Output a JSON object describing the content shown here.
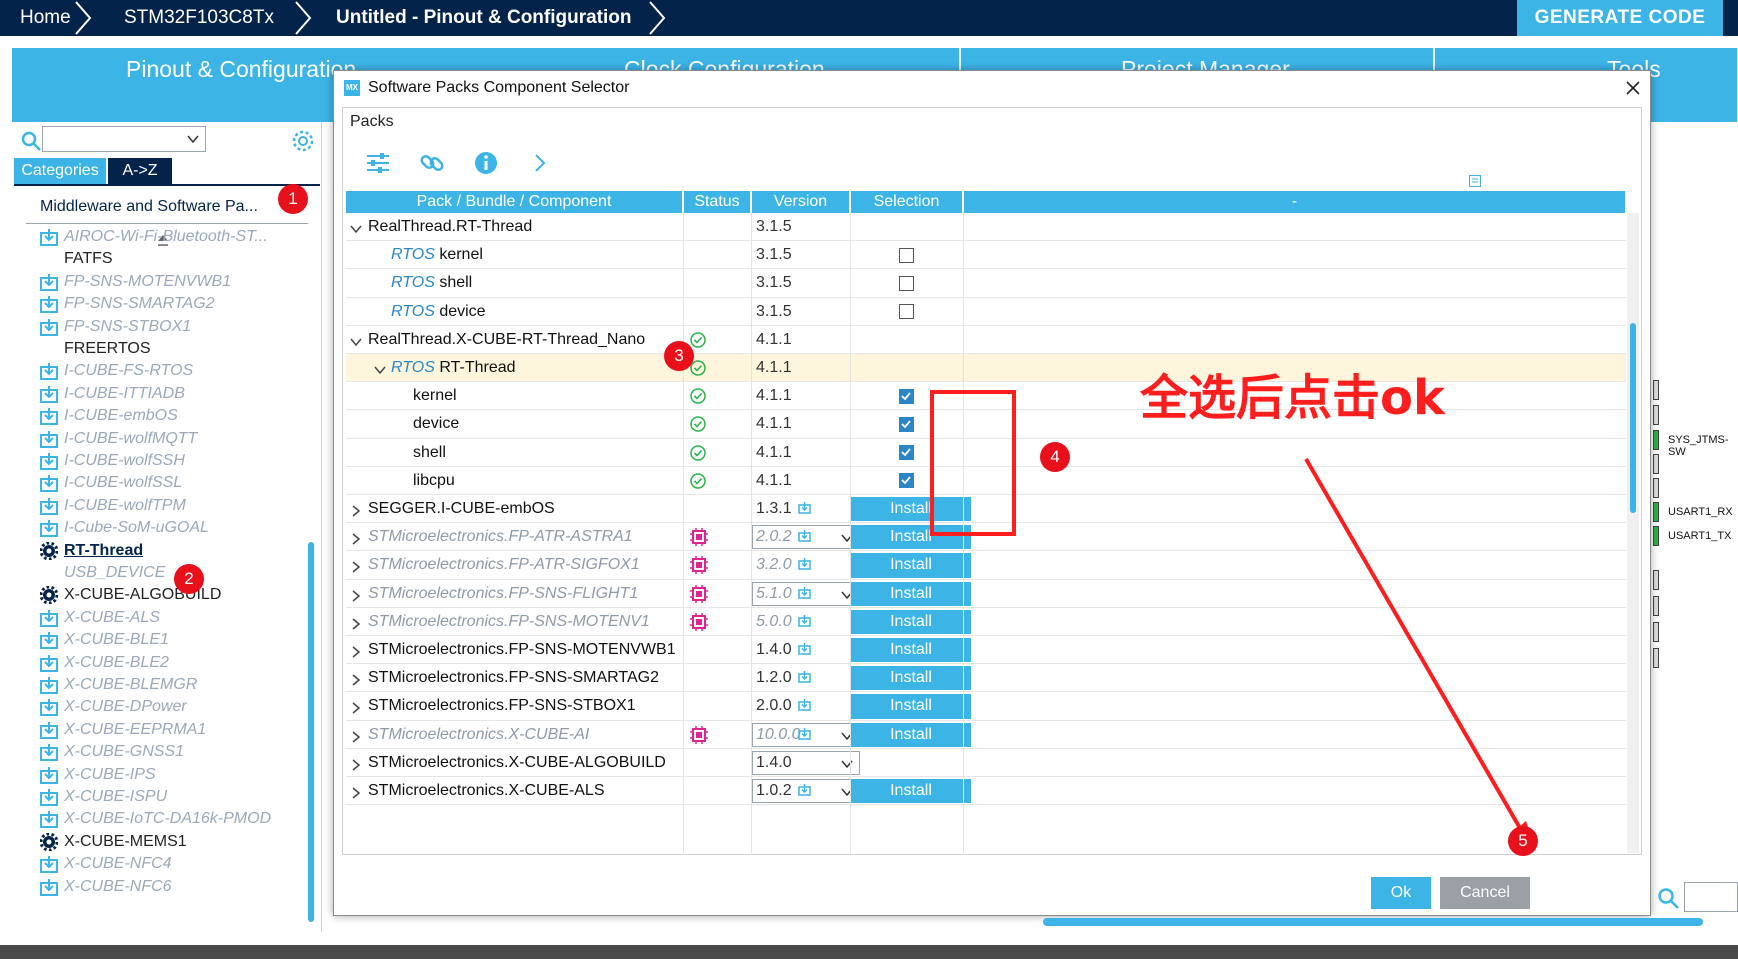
{
  "breadcrumb": {
    "home": "Home",
    "device": "STM32F103C8Tx",
    "project": "Untitled - Pinout & Configuration"
  },
  "generate_code": "GENERATE CODE",
  "tabs": [
    "Pinout & Configuration",
    "Clock Configuration",
    "Project Manager",
    "Tools"
  ],
  "left_panel": {
    "tab_categories": "Categories",
    "tab_az": "A->Z",
    "category_select": "Middleware and Software Pa...",
    "items": [
      {
        "label": "AIROC-Wi-Fi-Bluetooth-ST...",
        "style": "dim",
        "icon": "download-icon"
      },
      {
        "label": "FATFS",
        "style": "normal",
        "icon": ""
      },
      {
        "label": "FP-SNS-MOTENVWB1",
        "style": "dim",
        "icon": "download-icon"
      },
      {
        "label": "FP-SNS-SMARTAG2",
        "style": "dim",
        "icon": "download-icon"
      },
      {
        "label": "FP-SNS-STBOX1",
        "style": "dim",
        "icon": "download-icon"
      },
      {
        "label": "FREERTOS",
        "style": "normal",
        "icon": ""
      },
      {
        "label": "I-CUBE-FS-RTOS",
        "style": "dim",
        "icon": "download-icon"
      },
      {
        "label": "I-CUBE-ITTIADB",
        "style": "dim",
        "icon": "download-icon"
      },
      {
        "label": "I-CUBE-embOS",
        "style": "dim",
        "icon": "download-icon"
      },
      {
        "label": "I-CUBE-wolfMQTT",
        "style": "dim",
        "icon": "download-icon"
      },
      {
        "label": "I-CUBE-wolfSSH",
        "style": "dim",
        "icon": "download-icon"
      },
      {
        "label": "I-CUBE-wolfSSL",
        "style": "dim",
        "icon": "download-icon"
      },
      {
        "label": "I-CUBE-wolfTPM",
        "style": "dim",
        "icon": "download-icon"
      },
      {
        "label": "I-Cube-SoM-uGOAL",
        "style": "dim",
        "icon": "download-icon"
      },
      {
        "label": "RT-Thread",
        "style": "active",
        "icon": "gear-icon"
      },
      {
        "label": "USB_DEVICE",
        "style": "dim",
        "icon": ""
      },
      {
        "label": "X-CUBE-ALGOBUILD",
        "style": "normal",
        "icon": "gear-icon"
      },
      {
        "label": "X-CUBE-ALS",
        "style": "dim",
        "icon": "download-icon"
      },
      {
        "label": "X-CUBE-BLE1",
        "style": "dim",
        "icon": "download-icon"
      },
      {
        "label": "X-CUBE-BLE2",
        "style": "dim",
        "icon": "download-icon"
      },
      {
        "label": "X-CUBE-BLEMGR",
        "style": "dim",
        "icon": "download-icon"
      },
      {
        "label": "X-CUBE-DPower",
        "style": "dim",
        "icon": "download-icon"
      },
      {
        "label": "X-CUBE-EEPRMA1",
        "style": "dim",
        "icon": "download-icon"
      },
      {
        "label": "X-CUBE-GNSS1",
        "style": "dim",
        "icon": "download-icon"
      },
      {
        "label": "X-CUBE-IPS",
        "style": "dim",
        "icon": "download-icon"
      },
      {
        "label": "X-CUBE-ISPU",
        "style": "dim",
        "icon": "download-icon"
      },
      {
        "label": "X-CUBE-IoTC-DA16k-PMOD",
        "style": "dim",
        "icon": "download-icon"
      },
      {
        "label": "X-CUBE-MEMS1",
        "style": "normal",
        "icon": "gear-icon"
      },
      {
        "label": "X-CUBE-NFC4",
        "style": "dim",
        "icon": "download-icon"
      },
      {
        "label": "X-CUBE-NFC6",
        "style": "dim",
        "icon": "download-icon"
      }
    ]
  },
  "badges": [
    "1",
    "2",
    "3",
    "4",
    "5"
  ],
  "right_labels": [
    "SYS_JTMS-SW",
    "USART1_RX",
    "USART1_TX"
  ],
  "dialog": {
    "title": "Software Packs Component Selector",
    "packs_label": "Packs",
    "headers": [
      "Pack / Bundle / Component",
      "Status",
      "Version",
      "Selection",
      "-"
    ],
    "rtos_prefix": "RTOS",
    "install_label": "Install",
    "rows": [
      {
        "level": 0,
        "expand": "down",
        "name": "RealThread.RT-Thread",
        "dim": false,
        "status": "none",
        "version": "3.1.5",
        "selection": "none"
      },
      {
        "level": 1,
        "expand": "",
        "rtos": true,
        "name": "kernel",
        "dim": false,
        "status": "none",
        "version": "3.1.5",
        "selection": "unchecked"
      },
      {
        "level": 1,
        "expand": "",
        "rtos": true,
        "name": "shell",
        "dim": false,
        "status": "none",
        "version": "3.1.5",
        "selection": "unchecked"
      },
      {
        "level": 1,
        "expand": "",
        "rtos": true,
        "name": "device",
        "dim": false,
        "status": "none",
        "version": "3.1.5",
        "selection": "unchecked"
      },
      {
        "level": 0,
        "expand": "down",
        "name": "RealThread.X-CUBE-RT-Thread_Nano",
        "dim": false,
        "status": "ok",
        "version": "4.1.1",
        "selection": "none"
      },
      {
        "level": 1,
        "expand": "down",
        "rtos": true,
        "name": "RT-Thread",
        "dim": false,
        "status": "ok",
        "version": "4.1.1",
        "selection": "none",
        "highlight": true
      },
      {
        "level": 2,
        "expand": "",
        "name": "kernel",
        "dim": false,
        "status": "ok",
        "version": "4.1.1",
        "selection": "checked"
      },
      {
        "level": 2,
        "expand": "",
        "name": "device",
        "dim": false,
        "status": "ok",
        "version": "4.1.1",
        "selection": "checked"
      },
      {
        "level": 2,
        "expand": "",
        "name": "shell",
        "dim": false,
        "status": "ok",
        "version": "4.1.1",
        "selection": "checked"
      },
      {
        "level": 2,
        "expand": "",
        "name": "libcpu",
        "dim": false,
        "status": "ok",
        "version": "4.1.1",
        "selection": "checked"
      },
      {
        "level": 0,
        "expand": "right",
        "name": "SEGGER.I-CUBE-embOS",
        "dim": false,
        "status": "none",
        "version": "1.3.1",
        "verbox": false,
        "selection": "install"
      },
      {
        "level": 0,
        "expand": "right",
        "name": "STMicroelectronics.FP-ATR-ASTRA1",
        "dim": true,
        "status": "chip",
        "version": "2.0.2",
        "verbox": true,
        "selection": "install"
      },
      {
        "level": 0,
        "expand": "right",
        "name": "STMicroelectronics.FP-ATR-SIGFOX1",
        "dim": true,
        "status": "chip",
        "version": "3.2.0",
        "verbox": false,
        "selection": "install"
      },
      {
        "level": 0,
        "expand": "right",
        "name": "STMicroelectronics.FP-SNS-FLIGHT1",
        "dim": true,
        "status": "chip",
        "version": "5.1.0",
        "verbox": true,
        "selection": "install"
      },
      {
        "level": 0,
        "expand": "right",
        "name": "STMicroelectronics.FP-SNS-MOTENV1",
        "dim": true,
        "status": "chip",
        "version": "5.0.0",
        "verbox": false,
        "selection": "install"
      },
      {
        "level": 0,
        "expand": "right",
        "name": "STMicroelectronics.FP-SNS-MOTENVWB1",
        "dim": false,
        "status": "none",
        "version": "1.4.0",
        "verbox": false,
        "selection": "install"
      },
      {
        "level": 0,
        "expand": "right",
        "name": "STMicroelectronics.FP-SNS-SMARTAG2",
        "dim": false,
        "status": "none",
        "version": "1.2.0",
        "verbox": false,
        "selection": "install"
      },
      {
        "level": 0,
        "expand": "right",
        "name": "STMicroelectronics.FP-SNS-STBOX1",
        "dim": false,
        "status": "none",
        "version": "2.0.0",
        "verbox": false,
        "selection": "install"
      },
      {
        "level": 0,
        "expand": "right",
        "name": "STMicroelectronics.X-CUBE-AI",
        "dim": true,
        "status": "chip",
        "version": "10.0.0",
        "verbox": true,
        "selection": "install"
      },
      {
        "level": 0,
        "expand": "right",
        "name": "STMicroelectronics.X-CUBE-ALGOBUILD",
        "dim": false,
        "status": "none",
        "version": "1.4.0",
        "verbox": true,
        "selection": "none"
      },
      {
        "level": 0,
        "expand": "right",
        "name": "STMicroelectronics.X-CUBE-ALS",
        "dim": false,
        "status": "none",
        "version": "1.0.2",
        "verbox": true,
        "selection": "install"
      }
    ],
    "ok_label": "Ok",
    "cancel_label": "Cancel"
  },
  "annotation_text": "全选后点击ok",
  "colors": {
    "topbar": "#03234b",
    "accent": "#3cb4e6",
    "annotation": "#ff1e1e",
    "highlight_row": "#fdf6dc"
  }
}
